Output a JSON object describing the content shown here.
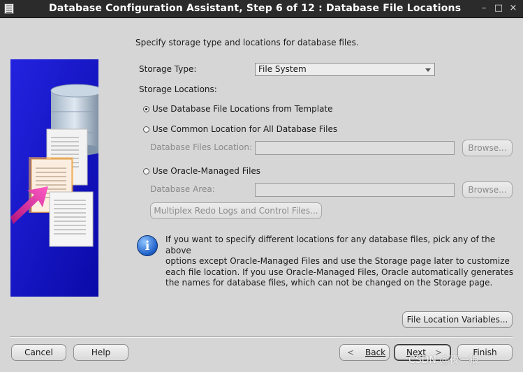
{
  "window": {
    "title": "Database Configuration Assistant, Step 6 of 12 : Database File Locations",
    "controls": [
      "–",
      "□",
      "×"
    ]
  },
  "intro": "Specify storage type and locations for database files.",
  "storage_type": {
    "label": "Storage Type:",
    "value": "File System"
  },
  "storage_locations": {
    "label": "Storage Locations:",
    "options": [
      "Use Database File Locations from Template",
      "Use Common Location for All Database Files",
      "Use Oracle-Managed Files"
    ],
    "selected_index": 0
  },
  "common_location": {
    "label": "Database Files Location:",
    "value": "",
    "browse": "Browse..."
  },
  "managed_files": {
    "label": "Database Area:",
    "value": "",
    "browse": "Browse...",
    "multiplex": "Multiplex Redo Logs and Control Files..."
  },
  "info": {
    "icon": "info-icon",
    "lines": [
      "If you want to specify different locations for any database files, pick any of the above",
      "options except Oracle-Managed Files and use the Storage page later to customize",
      "each file location. If you use Oracle-Managed Files, Oracle automatically generates",
      "the names for database files, which can not be changed on the Storage page."
    ]
  },
  "file_location_variables": "File Location Variables...",
  "footer": {
    "cancel": "Cancel",
    "help": "Help",
    "back": "Back",
    "next": "Next",
    "finish": "Finish"
  },
  "watermark": "CSDN @夜一狼",
  "colors": {
    "side_panel_blue": "#1a1ad0",
    "info_blue": "#1e5fc8",
    "arrow_magenta": "#e0289e"
  }
}
